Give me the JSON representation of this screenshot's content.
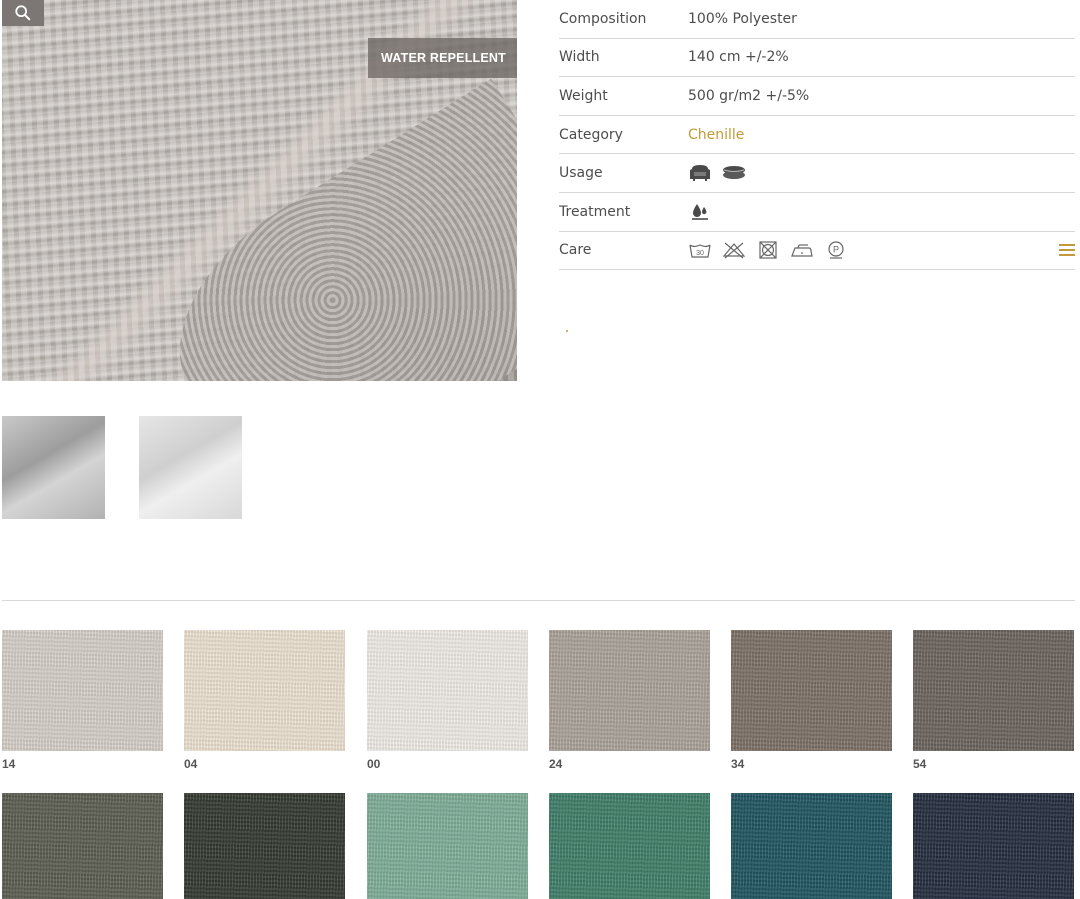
{
  "badge": {
    "label": "WATER REPELLENT"
  },
  "icons": {
    "zoom": "search-icon",
    "usage": [
      "armchair-icon",
      "cushion-icon"
    ],
    "treatment": "water-repellent-icon",
    "care": [
      "wash-30-icon",
      "no-tumble-dry-icon",
      "no-dryer-icon",
      "iron-low-icon",
      "dry-clean-p-icon"
    ],
    "menu": "hamburger-menu-icon"
  },
  "specs": {
    "composition": {
      "label": "Composition",
      "value": "100% Polyester"
    },
    "width": {
      "label": "Width",
      "value": "140 cm +/-2%"
    },
    "weight": {
      "label": "Weight",
      "value": "500 gr/m2 +/-5%"
    },
    "category": {
      "label": "Category",
      "value": "Chenille"
    },
    "usage": {
      "label": "Usage"
    },
    "treatment": {
      "label": "Treatment"
    },
    "care": {
      "label": "Care"
    }
  },
  "colors": {
    "accent": "#c29a3a",
    "text": "#4d4d4d",
    "divider": "#d8d8d8"
  },
  "swatches": [
    {
      "code": "14",
      "color": "#d6d0c8"
    },
    {
      "code": "04",
      "color": "#ece2d2"
    },
    {
      "code": "00",
      "color": "#f0ece6"
    },
    {
      "code": "24",
      "color": "#aba39a"
    },
    {
      "code": "34",
      "color": "#7d7167"
    },
    {
      "code": "54",
      "color": "#6c645e"
    },
    {
      "code": "",
      "color": "#5c5e52"
    },
    {
      "code": "",
      "color": "#343a30"
    },
    {
      "code": "",
      "color": "#7fae98"
    },
    {
      "code": "",
      "color": "#3f7e68"
    },
    {
      "code": "",
      "color": "#1f5560"
    },
    {
      "code": "",
      "color": "#252d40"
    }
  ]
}
